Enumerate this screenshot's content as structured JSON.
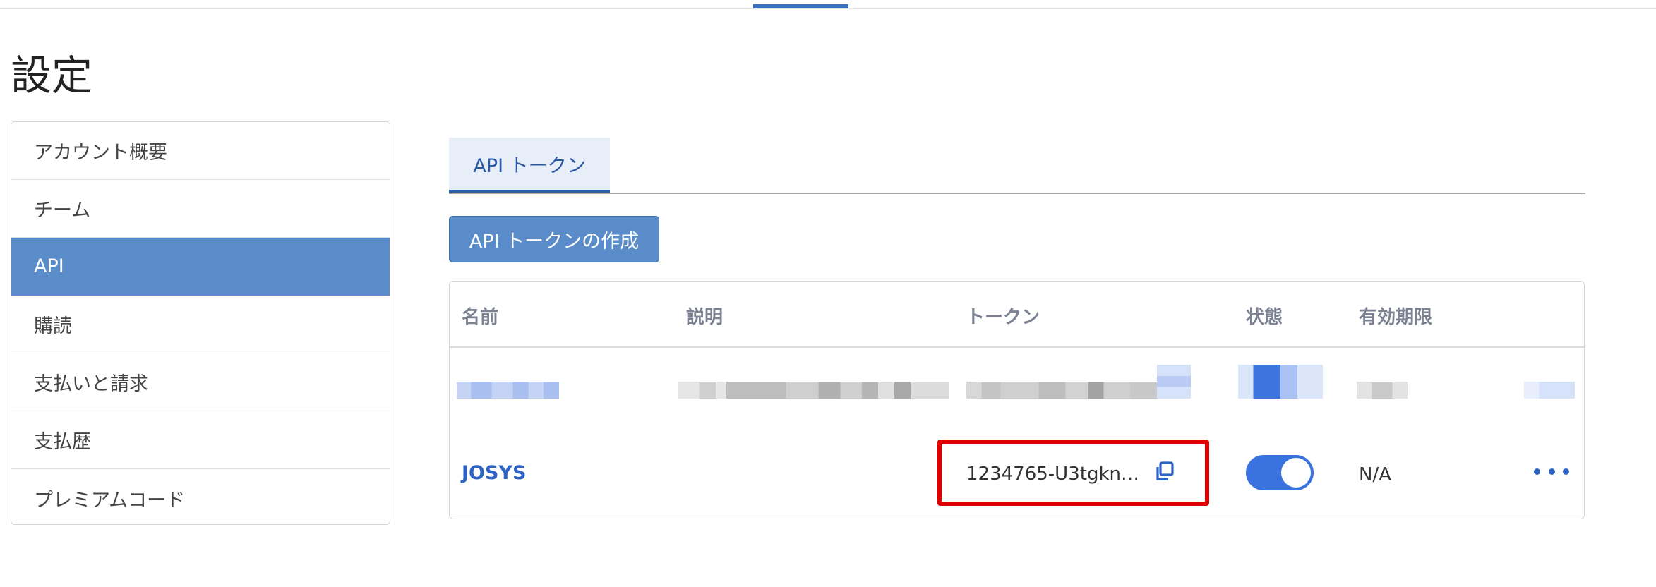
{
  "page_title": "設定",
  "sidebar": {
    "items": [
      {
        "label": "アカウント概要"
      },
      {
        "label": "チーム"
      },
      {
        "label": "API"
      },
      {
        "label": "購読"
      },
      {
        "label": "支払いと請求"
      },
      {
        "label": "支払歴"
      },
      {
        "label": "プレミアムコード"
      }
    ],
    "active_index": 2
  },
  "tabs": [
    {
      "label": "API トークン"
    }
  ],
  "create_button": {
    "label": "API トークンの作成"
  },
  "table": {
    "headers": {
      "name": "名前",
      "description": "説明",
      "token": "トークン",
      "status": "状態",
      "expiry": "有効期限"
    },
    "rows": [
      {
        "name": "JOSYS",
        "description": "",
        "token": "1234765-U3tgkn…",
        "enabled": true,
        "expiry": "N/A"
      }
    ]
  },
  "colors": {
    "accent": "#5a8cc9",
    "link": "#2d63c4",
    "highlight_border": "#e00000",
    "toggle_on": "#3a73e0"
  },
  "icons": {
    "copy": "copy-icon",
    "more": "more-horizontal-icon"
  }
}
